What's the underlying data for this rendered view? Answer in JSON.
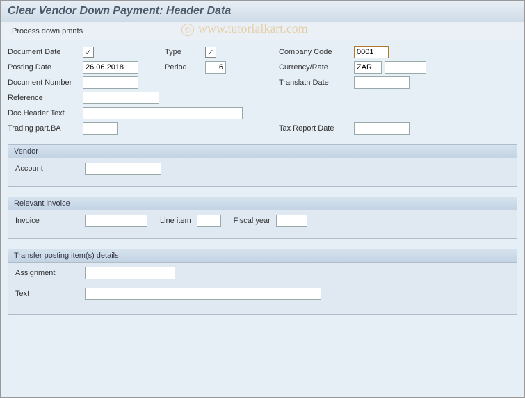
{
  "header": {
    "title": "Clear Vendor Down Payment: Header Data"
  },
  "toolbar": {
    "process_label": "Process down pmnts"
  },
  "watermark": "www.tutorialkart.com",
  "form": {
    "documentDate": {
      "label": "Document Date",
      "checked": true,
      "value": ""
    },
    "type": {
      "label": "Type",
      "checked": true,
      "value": ""
    },
    "companyCode": {
      "label": "Company Code",
      "value": "0001"
    },
    "postingDate": {
      "label": "Posting Date",
      "value": "26.06.2018"
    },
    "period": {
      "label": "Period",
      "value": "6"
    },
    "currencyRate": {
      "label": "Currency/Rate",
      "value": "ZAR",
      "rate": ""
    },
    "documentNumber": {
      "label": "Document Number",
      "value": ""
    },
    "translatnDate": {
      "label": "Translatn Date",
      "value": ""
    },
    "reference": {
      "label": "Reference",
      "value": ""
    },
    "docHeaderText": {
      "label": "Doc.Header Text",
      "value": ""
    },
    "tradingPartBA": {
      "label": "Trading part.BA",
      "value": ""
    },
    "taxReportDate": {
      "label": "Tax Report Date",
      "value": ""
    }
  },
  "groups": {
    "vendor": {
      "title": "Vendor",
      "account": {
        "label": "Account",
        "value": ""
      }
    },
    "invoice": {
      "title": "Relevant invoice",
      "invoice": {
        "label": "Invoice",
        "value": ""
      },
      "lineItem": {
        "label": "Line item",
        "value": ""
      },
      "fiscalYear": {
        "label": "Fiscal year",
        "value": ""
      }
    },
    "transfer": {
      "title": "Transfer posting item(s) details",
      "assignment": {
        "label": "Assignment",
        "value": ""
      },
      "text": {
        "label": "Text",
        "value": ""
      }
    }
  }
}
